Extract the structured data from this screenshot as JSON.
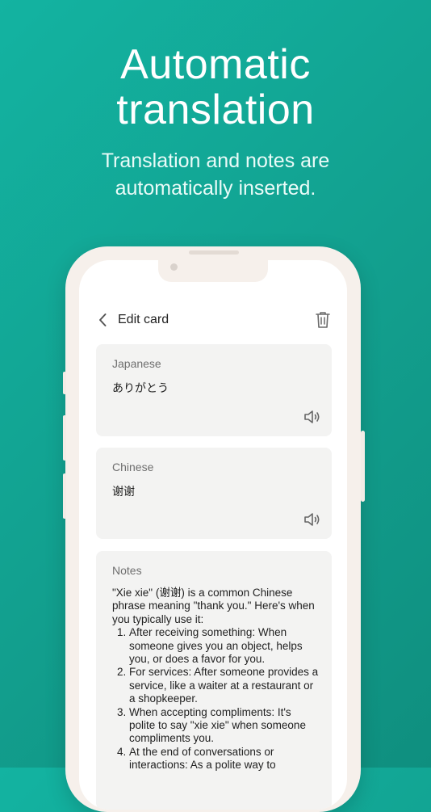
{
  "headline": {
    "line1": "Automatic",
    "line2": "translation"
  },
  "subline": {
    "line1": "Translation and notes are",
    "line2": "automatically inserted."
  },
  "app": {
    "title": "Edit card",
    "back_icon": "chevron-left-icon",
    "trash_icon": "trash-icon"
  },
  "cards": [
    {
      "label": "Japanese",
      "value": "ありがとう",
      "icon": "speaker-icon"
    },
    {
      "label": "Chinese",
      "value": "谢谢",
      "icon": "speaker-icon"
    }
  ],
  "notes": {
    "label": "Notes",
    "intro": "\"Xie xie\" (谢谢) is a common Chinese phrase meaning \"thank you.\" Here's when you typically use it:",
    "items": [
      "After receiving something: When someone gives you an object, helps you, or does a favor for you.",
      "For services: After someone provides a service, like a waiter at a restaurant or a shopkeeper.",
      "When accepting compliments: It's polite to say \"xie xie\" when someone compliments you.",
      "At the end of conversations or interactions: As a polite way to"
    ]
  },
  "colors": {
    "background": "#13b3a1",
    "card": "#f3f3f2",
    "phone_frame": "#f6f0eb"
  }
}
